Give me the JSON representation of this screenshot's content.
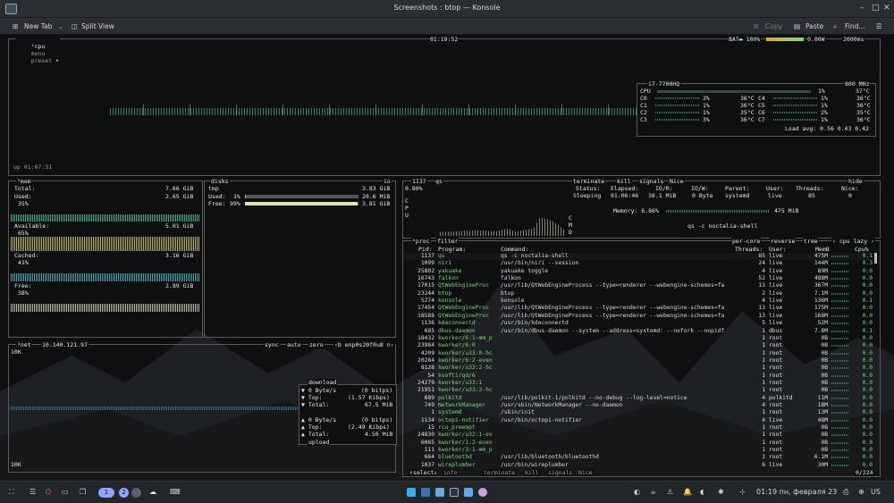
{
  "window": {
    "title": "Screenshots : btop — Konsole",
    "btn_min": "–",
    "btn_max": "□",
    "btn_close": "✕"
  },
  "toolbar": {
    "new_tab": "New Tab",
    "split_view": "Split View",
    "copy": "Copy",
    "paste": "Paste",
    "find": "Find..."
  },
  "cpu_box": {
    "tab_cpu": "cpu",
    "tab_menu": "menu",
    "tab_preset": "preset",
    "clock": "01:19:52",
    "battery": "BAT▬ 100%",
    "battery_power": "0.00W",
    "interval": "2000ms",
    "uptime": "up 01:07:31",
    "model": "i7-7700HQ",
    "freq": "800 MHz",
    "total_label": "CPU",
    "total_pct": "1%",
    "total_temp": "37°C",
    "cores": [
      {
        "name": "C0",
        "pct": "3%",
        "temp": "36°C"
      },
      {
        "name": "C1",
        "pct": "1%",
        "temp": "36°C"
      },
      {
        "name": "C2",
        "pct": "1%",
        "temp": "35°C"
      },
      {
        "name": "C3",
        "pct": "3%",
        "temp": "36°C"
      },
      {
        "name": "C4",
        "pct": "1%",
        "temp": "36°C"
      },
      {
        "name": "C5",
        "pct": "1%",
        "temp": "36°C"
      },
      {
        "name": "C6",
        "pct": "2%",
        "temp": "35°C"
      },
      {
        "name": "C7",
        "pct": "1%",
        "temp": "36°C"
      }
    ],
    "load_avg": "Load avg: 0.56 0.43 0.42"
  },
  "mem_box": {
    "title": "mem",
    "total_label": "Total:",
    "total": "7.66 GiB",
    "used_label": "Used:",
    "used": "2.65 GiB",
    "used_pct": "35%",
    "avail_label": "Available:",
    "avail": "5.01 GiB",
    "avail_pct": "65%",
    "cached_label": "Cached:",
    "cached": "3.16 GiB",
    "cached_pct": "41%",
    "free_label": "Free:",
    "free": "2.89 GiB",
    "free_pct": "38%"
  },
  "disks_box": {
    "title": "disks",
    "io": "io",
    "name": "tmp",
    "size": "3.83 GiB",
    "used_label": "Used:",
    "used_pct": "1%",
    "used": "20.6 MiB",
    "used_level": 0.01,
    "free_label": "Free:",
    "free_pct": "99%",
    "free": "3.81 GiB",
    "free_level": 0.99
  },
  "net_box": {
    "title": "net",
    "ip": "10.140.121.97",
    "sync": "sync",
    "auto": "auto",
    "zero": "zero",
    "iface": "enp0s20f0u8",
    "scale_top": "10K",
    "scale_bottom": "10K",
    "download": "download",
    "dl_rate": "▼ 0 Byte/s",
    "dl_bits": "(0 bitps)",
    "dl_top_label": "▼ Top:",
    "dl_top": "(1.57 Kibps)",
    "dl_total_label": "▼ Total:",
    "dl_total": "67.5 MiB",
    "ul_rate": "▲ 0 Byte/s",
    "ul_bits": "(0 bitps)",
    "ul_top_label": "▲ Top:",
    "ul_top": "(2.49 Kibps)",
    "ul_total_label": "▲ Total:",
    "ul_total": "4.50 MiB",
    "upload": "upload"
  },
  "detail_box": {
    "pid": "1137",
    "name": "qs",
    "cpu_pct": "0.80%",
    "terminate": "terminate",
    "kill": "kill",
    "signals": "signals",
    "nice": "Nice",
    "hide": "hide",
    "h_status": "Status:",
    "h_elapsed": "Elapsed:",
    "h_ior": "IO/R:",
    "h_iow": "IO/W:",
    "h_parent": "Parent:",
    "h_user": "User:",
    "h_threads": "Threads:",
    "h_nice": "Nice:",
    "status": "Sleeping",
    "elapsed": "01:06:46",
    "ior": "38.1 MiB",
    "iow": "0 Byte",
    "parent": "systemd",
    "user": "live",
    "threads": "85",
    "nice_v": "0",
    "memory": "Memory: 6.86%",
    "memory_val": "475 MiB",
    "cmd": "qs -c noctalia-shell",
    "cpu_letters": "C\nP\nU",
    "cmd_letters": "C\nM\nD"
  },
  "proc_box": {
    "title": "proc",
    "filter": "filter",
    "per_core": "per-core",
    "reverse": "reverse",
    "tree": "tree",
    "sort": "cpu lazy",
    "col_pid": "Pid:",
    "col_prog": "Program:",
    "col_cmd": "Command:",
    "col_thr": "Threads:",
    "col_user": "User:",
    "col_mem": "MemB",
    "col_cpu": "Cpu%",
    "footer_select": "select",
    "footer_info": "info",
    "footer_terminate": "terminate",
    "footer_kill": "kill",
    "footer_signals": "signals",
    "footer_nice": "Nice",
    "count": "0/224",
    "rows": [
      {
        "pid": "1137",
        "prog": "qs",
        "cmd": "qs -c noctalia-shell",
        "thr": "85",
        "user": "live",
        "mem": "475M",
        "cpu": "0.1"
      },
      {
        "pid": "1099",
        "prog": "niri",
        "cmd": "/usr/bin/niri --session",
        "thr": "24",
        "user": "live",
        "mem": "144M",
        "cpu": "0.3"
      },
      {
        "pid": "25802",
        "prog": "yakuake",
        "cmd": "yakuake toggle",
        "thr": "4",
        "user": "live",
        "mem": "89M",
        "cpu": "0.0"
      },
      {
        "pid": "16743",
        "prog": "falkon",
        "cmd": "falkon",
        "thr": "52",
        "user": "live",
        "mem": "488M",
        "cpu": "0.0"
      },
      {
        "pid": "17015",
        "prog": "QtWebEngineProc",
        "cmd": "/usr/lib/QtWebEngineProcess --type=renderer --webengine-schemes=fa",
        "thr": "13",
        "user": "live",
        "mem": "367M",
        "cpu": "0.0"
      },
      {
        "pid": "23244",
        "prog": "btop",
        "cmd": "btop",
        "thr": "2",
        "user": "live",
        "mem": "7.1M",
        "cpu": "0.0"
      },
      {
        "pid": "5274",
        "prog": "konsole",
        "cmd": "konsole",
        "thr": "4",
        "user": "live",
        "mem": "136M",
        "cpu": "0.1"
      },
      {
        "pid": "17454",
        "prog": "QtWebEngineProc",
        "cmd": "/usr/lib/QtWebEngineProcess --type=renderer --webengine-schemes=fa",
        "thr": "13",
        "user": "live",
        "mem": "175M",
        "cpu": "0.0"
      },
      {
        "pid": "18588",
        "prog": "QtWebEngineProc",
        "cmd": "/usr/lib/QtWebEngineProcess --type=renderer --webengine-schemes=fa",
        "thr": "13",
        "user": "live",
        "mem": "168M",
        "cpu": "0.0"
      },
      {
        "pid": "1136",
        "prog": "kdeconnectd",
        "cmd": "/usr/bin/kdeconnectd",
        "thr": "5",
        "user": "live",
        "mem": "52M",
        "cpu": "0.0"
      },
      {
        "pid": "685",
        "prog": "dbus-daemon",
        "cmd": "/usr/bin/dbus-daemon --system --address=systemd: --nofork --nopidf",
        "thr": "1",
        "user": "dbus",
        "mem": "7.8M",
        "cpu": "0.1"
      },
      {
        "pid": "18432",
        "prog": "kworker/6:1-mm_p",
        "cmd": "",
        "thr": "1",
        "user": "root",
        "mem": "0B",
        "cpu": "0.0"
      },
      {
        "pid": "23984",
        "prog": "kworker/6:0",
        "cmd": "",
        "thr": "1",
        "user": "root",
        "mem": "0B",
        "cpu": "0.0"
      },
      {
        "pid": "4209",
        "prog": "kworker/u33:0-hc",
        "cmd": "",
        "thr": "1",
        "user": "root",
        "mem": "0B",
        "cpu": "0.0"
      },
      {
        "pid": "20284",
        "prog": "kworker/6:2-even",
        "cmd": "",
        "thr": "1",
        "user": "root",
        "mem": "0B",
        "cpu": "0.0"
      },
      {
        "pid": "8128",
        "prog": "kworker/u33:2-hc",
        "cmd": "",
        "thr": "1",
        "user": "root",
        "mem": "0B",
        "cpu": "0.0"
      },
      {
        "pid": "54",
        "prog": "ksoftirqd/6",
        "cmd": "",
        "thr": "1",
        "user": "root",
        "mem": "0B",
        "cpu": "0.0"
      },
      {
        "pid": "24279",
        "prog": "kworker/u33:1",
        "cmd": "",
        "thr": "1",
        "user": "root",
        "mem": "0B",
        "cpu": "0.0"
      },
      {
        "pid": "21951",
        "prog": "kworker/u33:3-hc",
        "cmd": "",
        "thr": "1",
        "user": "root",
        "mem": "0B",
        "cpu": "0.0"
      },
      {
        "pid": "689",
        "prog": "polkitd",
        "cmd": "/usr/lib/polkit-1/polkitd --no-debug --log-level=notice",
        "thr": "4",
        "user": "polkitd",
        "mem": "11M",
        "cpu": "0.0"
      },
      {
        "pid": "749",
        "prog": "NetworkManager",
        "cmd": "/usr/sbin/NetworkManager --no-daemon",
        "thr": "4",
        "user": "root",
        "mem": "18M",
        "cpu": "0.0"
      },
      {
        "pid": "1",
        "prog": "systemd",
        "cmd": "/sbin/init",
        "thr": "1",
        "user": "root",
        "mem": "13M",
        "cpu": "0.0"
      },
      {
        "pid": "1134",
        "prog": "octopi-notifier",
        "cmd": "/usr/bin/octopi-notifier",
        "thr": "4",
        "user": "live",
        "mem": "48M",
        "cpu": "0.0"
      },
      {
        "pid": "15",
        "prog": "rcu_preempt",
        "cmd": "",
        "thr": "1",
        "user": "root",
        "mem": "0B",
        "cpu": "0.0"
      },
      {
        "pid": "24830",
        "prog": "kworker/u32:1-ev",
        "cmd": "",
        "thr": "1",
        "user": "root",
        "mem": "0B",
        "cpu": "0.0"
      },
      {
        "pid": "6065",
        "prog": "kworker/1:2-even",
        "cmd": "",
        "thr": "1",
        "user": "root",
        "mem": "0B",
        "cpu": "0.0"
      },
      {
        "pid": "111",
        "prog": "kworker/3:1-mm_p",
        "cmd": "",
        "thr": "1",
        "user": "root",
        "mem": "0B",
        "cpu": "0.0"
      },
      {
        "pid": "664",
        "prog": "bluetoothd",
        "cmd": "/usr/lib/bluetooth/bluetoothd",
        "thr": "1",
        "user": "root",
        "mem": "6.1M",
        "cpu": "0.0"
      },
      {
        "pid": "1037",
        "prog": "wireplumber",
        "cmd": "/usr/bin/wireplumber",
        "thr": "6",
        "user": "live",
        "mem": "30M",
        "cpu": "0.0"
      }
    ]
  },
  "taskbar": {
    "ws1": "1",
    "ws2": "2",
    "clock": "01:19 пн, февраля 23",
    "layout": "US"
  },
  "colors": {
    "accent_green": "#7fd37f",
    "accent_cyan": "#5ccfcf",
    "border": "#5a5a5a"
  }
}
